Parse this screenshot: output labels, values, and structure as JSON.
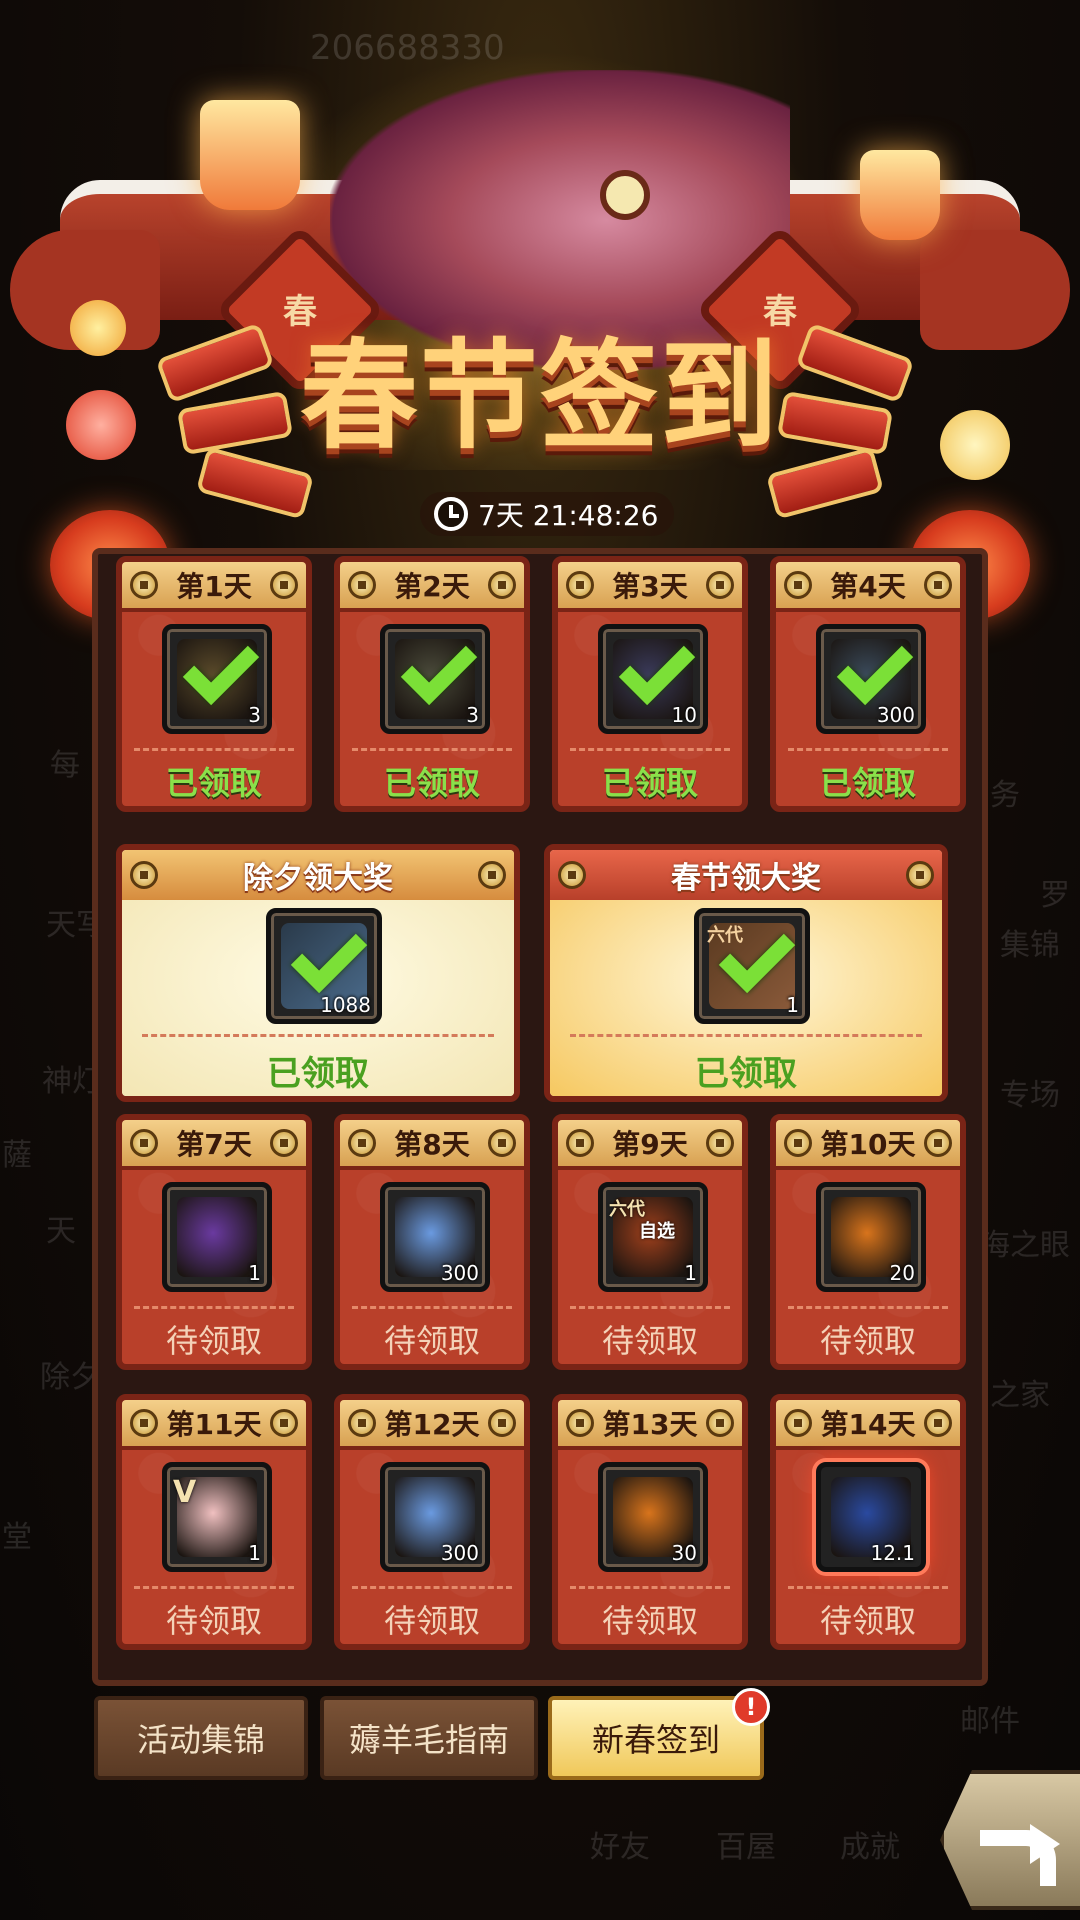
{
  "background": {
    "uid": "206688330",
    "side_labels": [
      "每",
      "天写",
      "神灯",
      "薩",
      "天",
      "除夕",
      "堂",
      "务",
      "罗",
      "集锦",
      "专场",
      "海之眼",
      "之家",
      "邮件",
      "好友",
      "百屋",
      "成就"
    ]
  },
  "header": {
    "title": "春节签到",
    "seal_char": "春",
    "timer": "7天 21:48:26"
  },
  "days": [
    {
      "label": "第1天",
      "qty": "3",
      "status": "已领取",
      "claimed": true,
      "item": "treasure-chest-icon",
      "color": "#5a4a2a"
    },
    {
      "label": "第2天",
      "qty": "3",
      "status": "已领取",
      "claimed": true,
      "item": "ore-icon",
      "color": "#4a4a3a"
    },
    {
      "label": "第3天",
      "qty": "10",
      "status": "已领取",
      "claimed": true,
      "item": "crate-icon",
      "color": "#3a3a5a"
    },
    {
      "label": "第4天",
      "qty": "300",
      "status": "已领取",
      "claimed": true,
      "item": "crystal-icon",
      "color": "#3a4a5a"
    },
    {
      "label": "第7天",
      "qty": "1",
      "status": "待领取",
      "claimed": false,
      "item": "golden-claw-chest-icon",
      "color": "#6a3aa0"
    },
    {
      "label": "第8天",
      "qty": "300",
      "status": "待领取",
      "claimed": false,
      "item": "blue-crystal-icon",
      "color": "#6a9ae0"
    },
    {
      "label": "第9天",
      "qty": "1",
      "status": "待领取",
      "claimed": false,
      "item": "selection-jar-icon",
      "color": "#a0401c",
      "item_text": [
        "六代",
        "自选"
      ]
    },
    {
      "label": "第10天",
      "qty": "20",
      "status": "待领取",
      "claimed": false,
      "item": "fire-orb-icon",
      "color": "#d8741c"
    },
    {
      "label": "第11天",
      "qty": "1",
      "status": "待领取",
      "claimed": false,
      "item": "pink-creature-icon",
      "color": "#f0c0c0",
      "item_text": [
        "V"
      ]
    },
    {
      "label": "第12天",
      "qty": "300",
      "status": "待领取",
      "claimed": false,
      "item": "blue-crystal-icon",
      "color": "#6a9ae0"
    },
    {
      "label": "第13天",
      "qty": "30",
      "status": "待领取",
      "claimed": false,
      "item": "fire-orb-icon",
      "color": "#d8741c"
    },
    {
      "label": "第14天",
      "qty": "12.1",
      "status": "待领取",
      "claimed": false,
      "item": "star-ticket-icon",
      "color": "#2a4aa0",
      "highlight": true
    }
  ],
  "big_rewards": [
    {
      "title": "除夕领大奖",
      "qty": "1088",
      "status": "已领取",
      "item": "crystal-icon"
    },
    {
      "title": "春节领大奖",
      "qty": "1",
      "status": "已领取",
      "item": "selection-jar-icon",
      "item_text": "六代"
    }
  ],
  "tabs": [
    {
      "label": "活动集锦",
      "active": false
    },
    {
      "label": "薅羊毛指南",
      "active": false
    },
    {
      "label": "新春签到",
      "active": true,
      "badge": "!"
    }
  ],
  "colors": {
    "accent_gold": "#ffd27a",
    "card_red": "#b9402a",
    "claimed_green": "#8ae04a",
    "pending_text": "#f4d2b8"
  }
}
